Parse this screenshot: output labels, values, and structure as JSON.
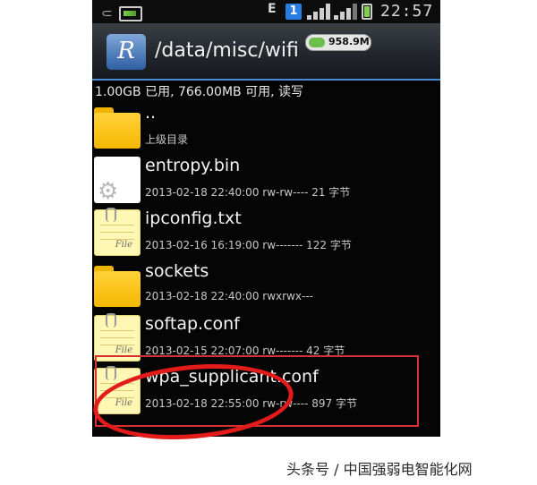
{
  "status_bar": {
    "network_type": "E",
    "sim_slot": "1",
    "time": "22:57",
    "icons": [
      "usb-icon",
      "image-notification-icon",
      "signal-icon",
      "battery-icon"
    ]
  },
  "title_bar": {
    "app_icon_letter": "R",
    "path": "/data/misc/wifi",
    "storage_badge": "958.9M"
  },
  "storage_info": "1.00GB 已用, 766.00MB 可用, 读写",
  "files": [
    {
      "name": "..",
      "meta": "上级目录",
      "type": "folder"
    },
    {
      "name": "entropy.bin",
      "meta": "2013-02-18 22:40:00  rw-rw----  21 字节",
      "type": "binary"
    },
    {
      "name": "ipconfig.txt",
      "meta": "2013-02-16 16:19:00  rw-------  122 字节",
      "type": "text"
    },
    {
      "name": "sockets",
      "meta": "2013-02-18 22:40:00  rwxrwx---",
      "type": "folder"
    },
    {
      "name": "softap.conf",
      "meta": "2013-02-15 22:07:00  rw-------  42 字节",
      "type": "text"
    },
    {
      "name": "wpa_supplicant.conf",
      "meta": "2013-02-18 22:55:00  rw-rw----  897 字节",
      "type": "text"
    }
  ],
  "note_icon_label": "File",
  "watermark": "头条号 / 中国强弱电智能化网",
  "colors": {
    "folder": "#f6b800",
    "highlight": "#e31b1b",
    "accent": "#4a8ad8"
  }
}
